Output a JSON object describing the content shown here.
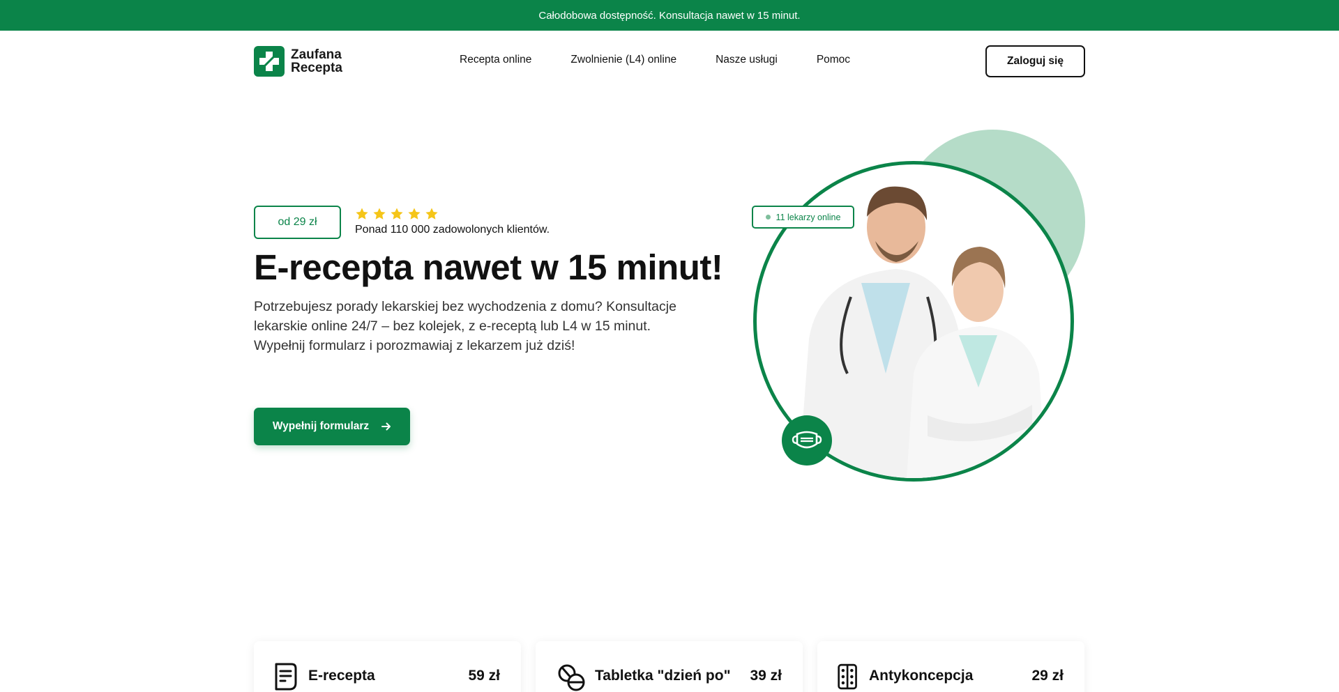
{
  "topbar": {
    "text": "Całodobowa dostępność. Konsultacja nawet w 15 minut."
  },
  "header": {
    "logo_line1": "Zaufana",
    "logo_line2": "Recepta",
    "nav": [
      {
        "label": "Recepta online"
      },
      {
        "label": "Zwolnienie (L4) online"
      },
      {
        "label": "Nasze usługi"
      },
      {
        "label": "Pomoc"
      }
    ],
    "login_label": "Zaloguj się"
  },
  "hero": {
    "price_badge": "od 29 zł",
    "rating_stars": 5,
    "clients_text": "Ponad 110 000 zadowolonych klientów.",
    "title": "E-recepta nawet w 15 minut!",
    "description": "Potrzebujesz porady lekarskiej bez wychodzenia z domu? Konsultacje lekarskie online 24/7 – bez kolejek, z e-receptą lub L4 w 15 minut. Wypełnij formularz i porozmawiaj z lekarzem już dziś!",
    "cta_label": "Wypełnij formularz",
    "online_badge": "11 lekarzy online"
  },
  "services": [
    {
      "icon": "prescription-document-icon",
      "title": "E-recepta",
      "price": "59 zł"
    },
    {
      "icon": "pills-icon",
      "title": "Tabletka \"dzień po\"",
      "price": "39 zł"
    },
    {
      "icon": "pill-blister-icon",
      "title": "Antykoncepcja",
      "price": "29 zł"
    }
  ],
  "colors": {
    "brand": "#0b8449",
    "blob": "#b5dcc8",
    "star": "#f5c518"
  }
}
